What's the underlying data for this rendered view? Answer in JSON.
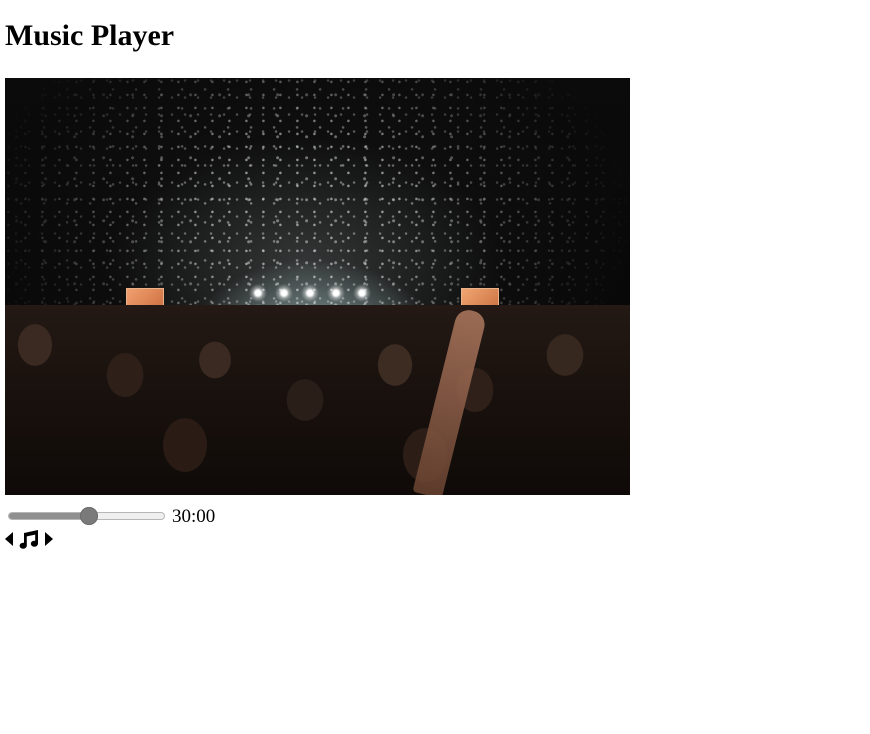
{
  "page": {
    "title": "Music Player"
  },
  "player": {
    "cover_image": "concert-crowd-image",
    "progress_fraction": 0.52,
    "time": "30:00",
    "icons": {
      "previous": "caret-left-icon",
      "music": "music-note-icon",
      "next": "caret-right-icon"
    }
  },
  "colors": {
    "text": "#000000",
    "slider_fill": "#8f8f8f",
    "slider_thumb": "#7a7a7a"
  }
}
